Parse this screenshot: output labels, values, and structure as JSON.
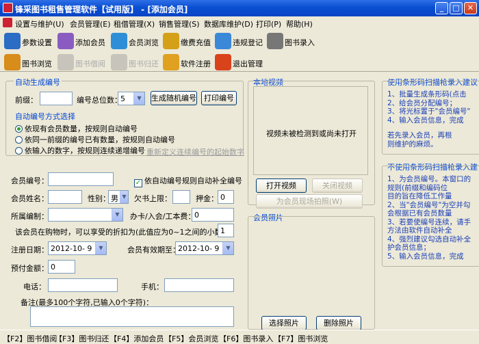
{
  "window": {
    "title": "锋采图书租售管理软件【试用版】 - [添加会员]",
    "min_icon": "minimize-icon",
    "max_icon": "maximize-icon",
    "close_icon": "close-icon"
  },
  "menu": [
    "设置与维护(U)",
    "会员管理(E)",
    "租借管理(X)",
    "销售管理(S)",
    "数据库维护(D)",
    "打印(P)",
    "帮助(H)"
  ],
  "toolbar": {
    "row1": [
      {
        "label": "参数设置",
        "icon": "settings-icon",
        "color": "#2b6cc4",
        "enabled": true
      },
      {
        "label": "添加会员",
        "icon": "add-user-icon",
        "color": "#8a5cc2",
        "enabled": true
      },
      {
        "label": "会员浏览",
        "icon": "users-icon",
        "color": "#2e8fd6",
        "enabled": true
      },
      {
        "label": "缴费充值",
        "icon": "money-icon",
        "color": "#d4a017",
        "enabled": true
      },
      {
        "label": "违规登记",
        "icon": "warning-icon",
        "color": "#3b88d9",
        "enabled": true
      },
      {
        "label": "图书录入",
        "icon": "book-icon",
        "color": "#777",
        "enabled": true
      }
    ],
    "row2": [
      {
        "label": "图书浏览",
        "icon": "search-book-icon",
        "color": "#d88c1a",
        "enabled": true
      },
      {
        "label": "图书借阅",
        "icon": "borrow-icon",
        "color": "#999",
        "enabled": false
      },
      {
        "label": "图书归还",
        "icon": "return-icon",
        "color": "#999",
        "enabled": false
      },
      {
        "label": "软件注册",
        "icon": "register-icon",
        "color": "#e0a020",
        "enabled": true
      },
      {
        "label": "退出管理",
        "icon": "exit-icon",
        "color": "#d9431c",
        "enabled": true
      }
    ]
  },
  "auto_code": {
    "title": "自动生成编号",
    "prefix_label": "前缀：",
    "prefix_value": "",
    "digits_label": "编号总位数：",
    "digits_value": "5",
    "gen_button": "生成随机编号",
    "print_button": "打印编号",
    "method_title": "自动编号方式选择",
    "options": [
      {
        "label": "依现有会员数量，按规则自动编号",
        "selected": true
      },
      {
        "label": "依同一前缀的编号已有数量，按规则自动编号",
        "selected": false
      },
      {
        "label": "依输入的数字，按规则连续递增编号",
        "selected": false
      }
    ],
    "redefine_link": "重新定义连续编号的起始数字"
  },
  "form": {
    "member_no_label": "会员编号：",
    "member_no_value": "",
    "auto_fill_label": "依自动编号规则自动补全编号",
    "auto_fill_checked": "✓",
    "name_label": "会员姓名：",
    "name_value": "",
    "gender_label": "性别：",
    "gender_value": "男",
    "limit_label": "欠书上限：",
    "limit_value": "",
    "deposit_label": "押金：",
    "deposit_value": "0",
    "unit_label": "所属编制：",
    "unit_value": "",
    "fee_label": "办卡/入会/工本费：",
    "fee_value": "0",
    "discount_label": "该会员在购物时，可以享受的折扣为(此值应为0~1之间的小数)：",
    "discount_value": "1",
    "reg_date_label": "注册日期：",
    "reg_date_value": "2012-10- 9",
    "expire_label": "会员有效期至：",
    "expire_value": "2012-10- 9",
    "prepaid_label": "预付金额：",
    "prepaid_value": "0",
    "phone_label": "电话：",
    "phone_value": "",
    "mobile_label": "手机：",
    "mobile_value": "",
    "notes_label": "备注(最多100个字符,已输入0个字符)：",
    "notes_value": ""
  },
  "video": {
    "title": "本地视频",
    "message": "视频未被检测到或尚未打开",
    "open_button": "打开视频",
    "close_button": "关闭视频",
    "capture_button": "为会员现场拍照(W)",
    "photo_title": "会员照片",
    "select_button": "选择照片",
    "delete_button": "删除照片"
  },
  "tips1": {
    "title": "使用条形码扫描枪录入建议",
    "lines": [
      "1、批量生成条形码(点击",
      "2、给会员分配编号；",
      "3、将光标置于\"会员编号\"",
      "4、输入会员信息，完成",
      "",
      "   若先录入会员，再根",
      "   则维护的麻烦。"
    ]
  },
  "tips2": {
    "title": "不使用条形码扫描枪录入建",
    "lines": [
      "1、为会员编号。本窗口的",
      "   规则(前缀和编码位",
      "   目的旨在降低工作量",
      "2、当\"会员编号\"为空并勾",
      "   会根据已有会员数量",
      "3、若要使编号连续，请手",
      "   方法由软件自动补全",
      "4、强烈建议勾选自动补全",
      "   护会员信息；",
      "5、输入会员信息，完成"
    ]
  },
  "status": [
    "【F2】图书借阅",
    "【F3】图书归还",
    "【F4】添加会员",
    "【F5】会员浏览",
    "【F6】图书录入",
    "【F7】图书浏览"
  ]
}
